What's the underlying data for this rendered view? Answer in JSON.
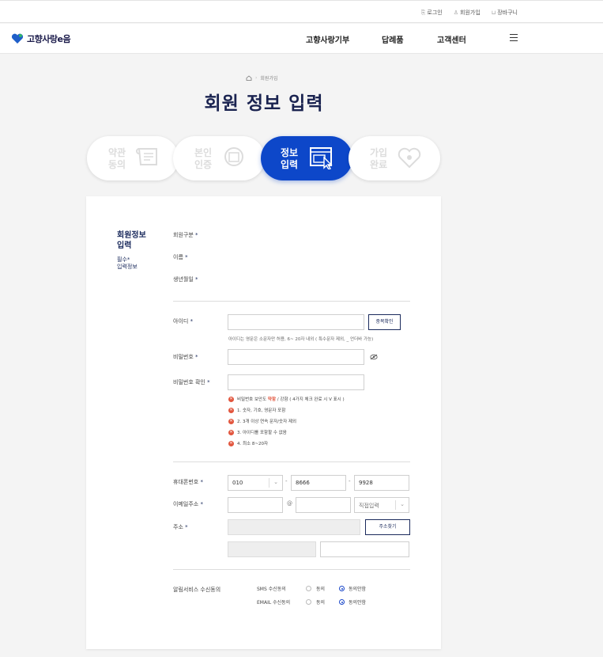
{
  "util": {
    "login": "로그인",
    "join": "회원가입",
    "cart": "장바구니"
  },
  "brand": {
    "name": "고향사랑e음"
  },
  "nav": [
    "고향사랑기부",
    "답례품",
    "고객센터"
  ],
  "breadcrumb": {
    "current": "회원가입"
  },
  "page_title": "회원 정보 입력",
  "steps": [
    {
      "l1": "약관",
      "l2": "동의"
    },
    {
      "l1": "본인",
      "l2": "인증"
    },
    {
      "l1": "정보",
      "l2": "입력"
    },
    {
      "l1": "가입",
      "l2": "완료"
    }
  ],
  "side": {
    "title1": "회원정보",
    "title2": "입력",
    "sub1": "필수*",
    "sub2": "입력정보"
  },
  "fields": {
    "member_type": "회원구분",
    "name": "이름",
    "birth": "생년월일",
    "id": "아이디",
    "id_hint": "아이디는 영문은 소문자만 허용, 6~ 20자 내외 ( 특수문자 제외, _ 언더바 가능)",
    "dup_btn": "중복확인",
    "pw": "비밀번호",
    "pw_confirm": "비밀번호 확인",
    "pw_strength_pre": "비밀번호 보안도 ",
    "pw_weak": "약함",
    "pw_strength_post": " / 강함 ( 4가지 체크 완료 시 V 표시 )",
    "rules": [
      "1. 숫자, 기호, 영문자 포함",
      "2. 3개 이상 연속 문자/숫자 제외",
      "3. 아이디를 포함할 수 없음",
      "4. 최소 8~20자"
    ],
    "phone": "휴대폰번호",
    "phone1": "010",
    "phone2": "8666",
    "phone3": "9928",
    "email": "이메일주소",
    "at": "@",
    "email_domain": "직접입력",
    "address": "주소",
    "addr_btn": "주소찾기",
    "notify": "알림서비스 수신동의",
    "sms": "SMS 수신동의",
    "email_agree": "EMAIL 수신동의",
    "agree": "동의",
    "disagree": "동의안함"
  },
  "colors": {
    "primary": "#0d47c9",
    "navy": "#1a2350",
    "error": "#e2553d"
  }
}
